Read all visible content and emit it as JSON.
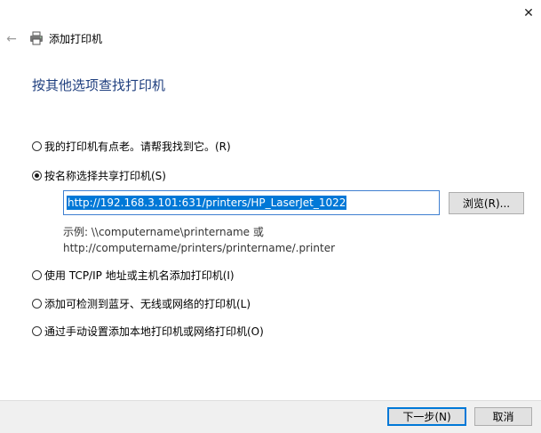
{
  "window": {
    "title": "添加打印机",
    "close_glyph": "✕",
    "back_glyph": "←"
  },
  "heading": "按其他选项查找打印机",
  "options": [
    {
      "label": "我的打印机有点老。请帮我找到它。(R)",
      "checked": false
    },
    {
      "label": "按名称选择共享打印机(S)",
      "checked": true
    },
    {
      "label": "使用 TCP/IP 地址或主机名添加打印机(I)",
      "checked": false
    },
    {
      "label": "添加可检测到蓝牙、无线或网络的打印机(L)",
      "checked": false
    },
    {
      "label": "通过手动设置添加本地打印机或网络打印机(O)",
      "checked": false
    }
  ],
  "shared_printer": {
    "value": "http://192.168.3.101:631/printers/HP_LaserJet_1022",
    "browse_label": "浏览(R)...",
    "example_line1": "示例: \\\\computername\\printername 或",
    "example_line2": "http://computername/printers/printername/.printer"
  },
  "footer": {
    "next_label": "下一步(N)",
    "cancel_label": "取消"
  },
  "colors": {
    "heading": "#1f3f7f",
    "selection": "#0078d7",
    "footer_bg": "#f0f0f0"
  },
  "icons": {
    "close": "close-icon",
    "back": "back-arrow-icon",
    "printer": "printer-icon"
  }
}
